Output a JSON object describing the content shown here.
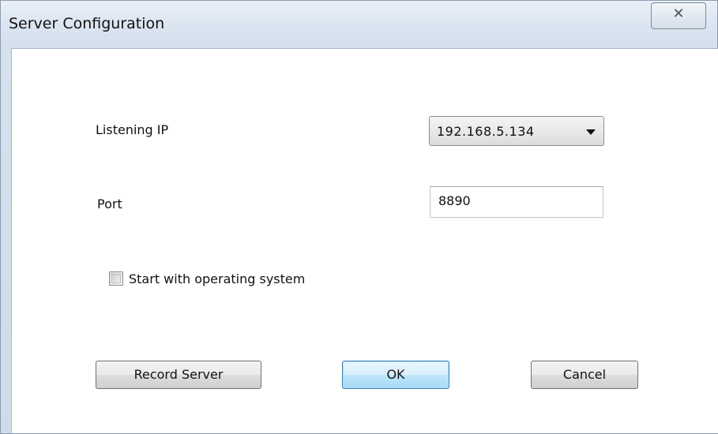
{
  "window": {
    "title": "Server Configuration",
    "close_glyph": "✕"
  },
  "form": {
    "listening_ip_label": "Listening IP",
    "listening_ip_value": "192.168.5.134",
    "port_label": "Port",
    "port_value": "8890",
    "start_with_os_label": "Start with operating system",
    "start_with_os_checked": false
  },
  "buttons": {
    "record_server": "Record Server",
    "ok": "OK",
    "cancel": "Cancel"
  },
  "icons": {
    "close": "close-icon",
    "dropdown": "chevron-down-icon"
  }
}
